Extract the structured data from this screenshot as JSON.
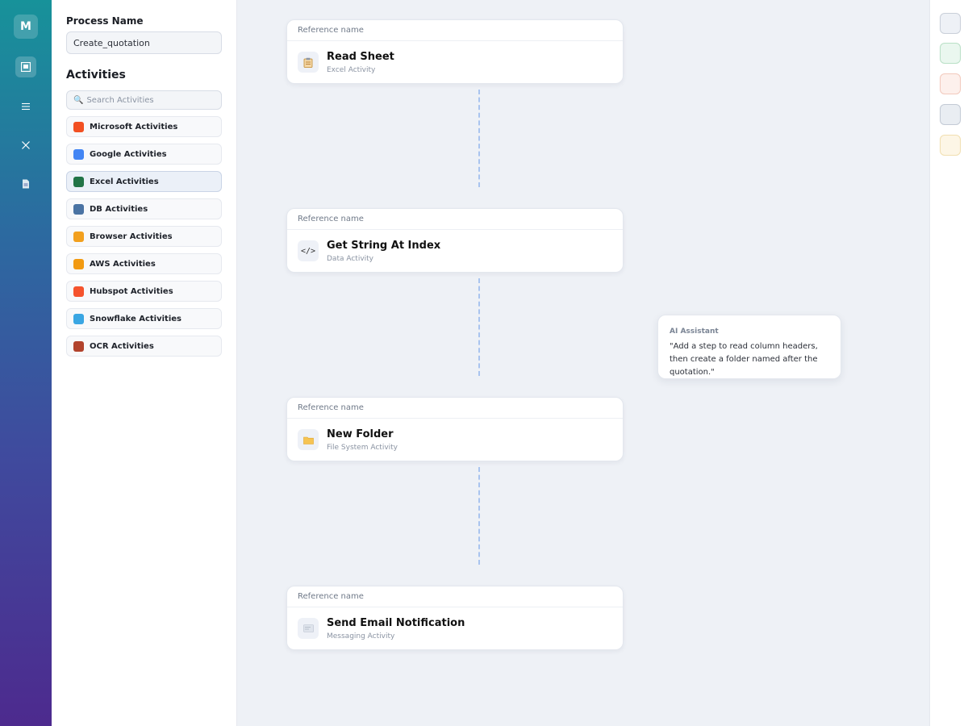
{
  "rail": {
    "logo_text": "M",
    "items": [
      {
        "name": "process-icon",
        "glyph": "▣",
        "active": true
      },
      {
        "name": "list-icon",
        "glyph": "☰",
        "active": false
      },
      {
        "name": "close-icon",
        "glyph": "✕",
        "active": false
      },
      {
        "name": "document-icon",
        "glyph": "doc",
        "active": false
      }
    ]
  },
  "sidebar": {
    "process_label": "Process Name",
    "process_value": "Create_quotation",
    "activities_label": "Activities",
    "search_placeholder": "Search Activities",
    "search_icon": "magnifier-icon",
    "categories": [
      {
        "label": "Microsoft Activities",
        "color": "#f25022"
      },
      {
        "label": "Google Activities",
        "color": "#4285f4"
      },
      {
        "label": "Excel Activities",
        "color": "#217346",
        "active": true
      },
      {
        "label": "DB Activities",
        "color": "#4a73a3"
      },
      {
        "label": "Browser Activities",
        "color": "#f2a01e"
      },
      {
        "label": "AWS Activities",
        "color": "#f29a11"
      },
      {
        "label": "Hubspot Activities",
        "color": "#f5532d"
      },
      {
        "label": "Snowflake Activities",
        "color": "#3aa6e3"
      },
      {
        "label": "OCR Activities",
        "color": "#b2432c"
      }
    ]
  },
  "flow": {
    "steps": [
      {
        "header": "Reference name",
        "title": "Read Sheet",
        "subtitle": "Excel Activity",
        "icon": "clipboard-icon"
      },
      {
        "header": "Reference name",
        "title": "Get String At Index",
        "subtitle": "Data Activity",
        "icon": "code-icon"
      },
      {
        "header": "Reference name",
        "title": "New Folder",
        "subtitle": "File System Activity",
        "icon": "folder-icon"
      },
      {
        "header": "Reference name",
        "title": "Send Email Notification",
        "subtitle": "Messaging Activity",
        "icon": "email-icon"
      }
    ]
  },
  "ai_assistant": {
    "title": "AI Assistant",
    "message": "\"Add a step to read column headers, then create a folder named after the quotation.\""
  },
  "toolbar": {
    "tools": [
      {
        "name": "tool-gray-button",
        "bg": "#eef1f6",
        "border": "#c9cfd9"
      },
      {
        "name": "tool-green-button",
        "bg": "#eaf7ef",
        "border": "#b9e0c6"
      },
      {
        "name": "tool-red-button",
        "bg": "#fdf0ec",
        "border": "#f2c9bd"
      },
      {
        "name": "tool-slate-button",
        "bg": "#e9edf2",
        "border": "#c3cad5"
      },
      {
        "name": "tool-yellow-button",
        "bg": "#fdf6e6",
        "border": "#f1dfb1"
      }
    ]
  }
}
